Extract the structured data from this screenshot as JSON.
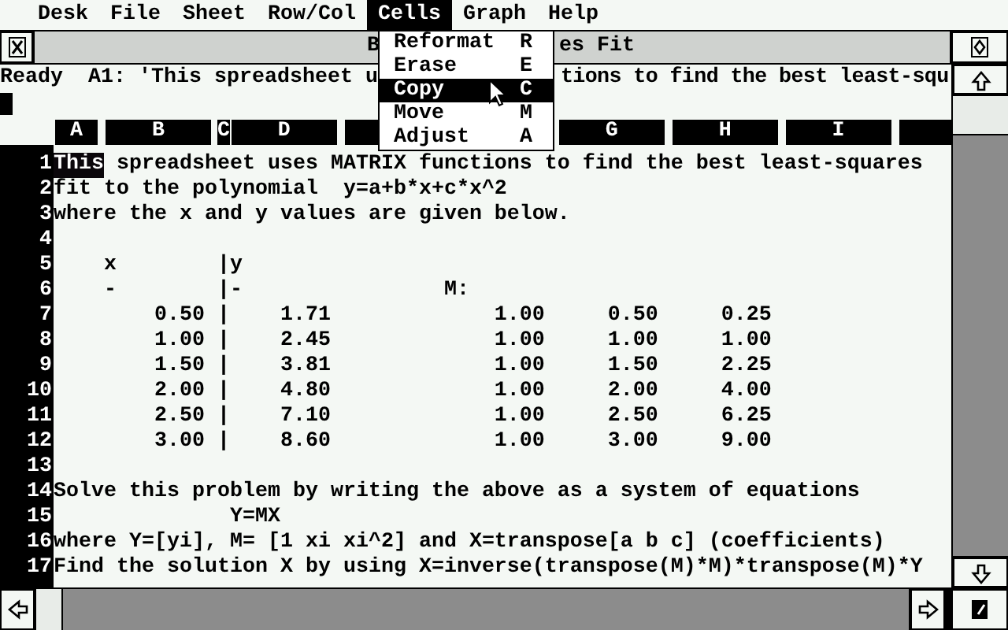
{
  "menu_bar": [
    {
      "label": "Desk",
      "selected": false
    },
    {
      "label": "File",
      "selected": false
    },
    {
      "label": "Sheet",
      "selected": false
    },
    {
      "label": "Row/Col",
      "selected": false
    },
    {
      "label": "Cells",
      "selected": true
    },
    {
      "label": "Graph",
      "selected": false
    },
    {
      "label": "Help",
      "selected": false
    }
  ],
  "dropdown": {
    "items": [
      {
        "label": "Reformat",
        "shortcut": "R",
        "selected": false
      },
      {
        "label": "Erase",
        "shortcut": "E",
        "selected": false
      },
      {
        "label": "Copy",
        "shortcut": "C",
        "selected": true
      },
      {
        "label": "Move",
        "shortcut": "M",
        "selected": false
      },
      {
        "label": "Adjust",
        "shortcut": "A",
        "selected": false
      }
    ]
  },
  "window": {
    "title_visible": [
      "B",
      "es Fit"
    ]
  },
  "status_line": {
    "state": "Ready",
    "cell_contents": [
      "A1: 'This spreadsheet u",
      "tions to find the best least-squ"
    ]
  },
  "sheet": {
    "column_headers": [
      "A",
      "B",
      "C",
      "D",
      "G",
      "H",
      "I"
    ],
    "rows": [
      {
        "number": "1",
        "text": "This spreadsheet uses MATRIX functions to find the best least-squares",
        "selected": true
      },
      {
        "number": "2",
        "text": "fit to the polynomial  y=a+b*x+c*x^2",
        "selected": false
      },
      {
        "number": "3",
        "text": "where the x and y values are given below.",
        "selected": false
      },
      {
        "number": "4",
        "selected": false
      },
      {
        "number": "5",
        "text": "    x        |y",
        "selected": false
      },
      {
        "number": "6",
        "text": "    -        |-                M:",
        "selected": false
      },
      {
        "number": "7",
        "text": "        0.50 |    1.71             1.00     0.50     0.25",
        "selected": false
      },
      {
        "number": "8",
        "text": "        1.00 |    2.45             1.00     1.00     1.00",
        "selected": false
      },
      {
        "number": "9",
        "text": "        1.50 |    3.81             1.00     1.50     2.25",
        "selected": false
      },
      {
        "number": "10",
        "text": "        2.00 |    4.80             1.00     2.00     4.00",
        "selected": false
      },
      {
        "number": "11",
        "text": "        2.50 |    7.10             1.00     2.50     6.25",
        "selected": false
      },
      {
        "number": "12",
        "text": "        3.00 |    8.60             1.00     3.00     9.00",
        "selected": false
      },
      {
        "number": "13",
        "selected": false
      },
      {
        "number": "14",
        "text": "Solve this problem by writing the above as a system of equations",
        "selected": false
      },
      {
        "number": "15",
        "text": "              Y=MX",
        "selected": false
      },
      {
        "number": "16",
        "text": "where Y=[yi], M= [1 xi xi^2] and X=transpose[a b c] (coefficients)",
        "selected": false
      },
      {
        "number": "17",
        "text": "Find the solution X by using X=inverse(transpose(M)*M)*transpose(M)*Y",
        "selected": false
      }
    ]
  }
}
